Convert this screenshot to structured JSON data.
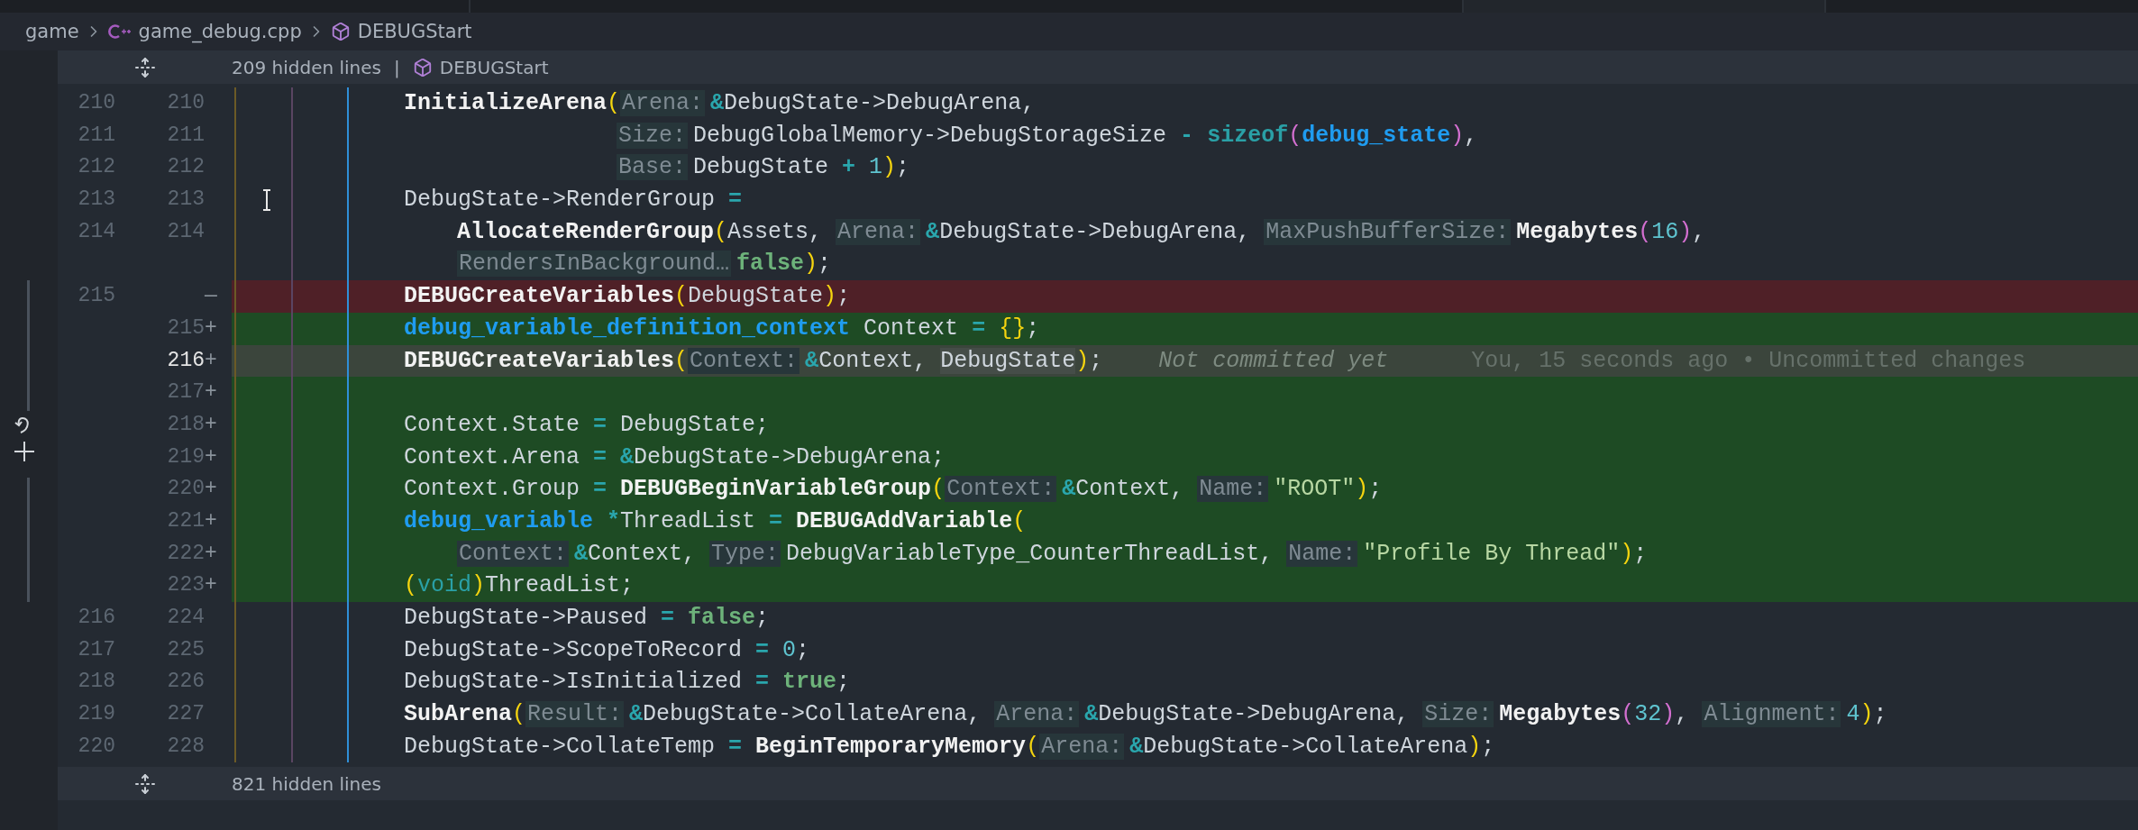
{
  "breadcrumb": {
    "items": [
      {
        "kind": "folder",
        "label": "game"
      },
      {
        "kind": "file",
        "label": "game_debug.cpp"
      },
      {
        "kind": "symbol",
        "label": "DEBUGStart"
      }
    ]
  },
  "top_fold": {
    "label": "209 hidden lines",
    "separator": "|",
    "symbol": "DEBUGStart"
  },
  "rows": [
    {
      "kind": "context",
      "old": "210",
      "new": "210",
      "current": false,
      "tokens": [
        {
          "kind": "fn",
          "text": "InitializeArena"
        },
        {
          "kind": "paren",
          "text": "("
        },
        {
          "kind": "hint",
          "text": "Arena:"
        },
        {
          "kind": "op",
          "text": "&"
        },
        {
          "kind": "plain",
          "text": "DebugState->DebugArena,"
        }
      ]
    },
    {
      "kind": "context",
      "old": "211",
      "new": "211",
      "current": false,
      "aligned": true,
      "tokens": [
        {
          "kind": "hint",
          "text": "Size:"
        },
        {
          "kind": "plain",
          "text": "DebugGlobalMemory->DebugStorageSize"
        },
        {
          "kind": "op",
          "text": " - "
        },
        {
          "kind": "builtin",
          "text": "sizeof"
        },
        {
          "kind": "paren2",
          "text": "("
        },
        {
          "kind": "kw",
          "text": "debug_state"
        },
        {
          "kind": "paren2",
          "text": ")"
        },
        {
          "kind": "plain",
          "text": ","
        }
      ]
    },
    {
      "kind": "context",
      "old": "212",
      "new": "212",
      "current": false,
      "aligned": true,
      "tokens": [
        {
          "kind": "hint",
          "text": "Base:"
        },
        {
          "kind": "plain",
          "text": "DebugState"
        },
        {
          "kind": "op",
          "text": " + "
        },
        {
          "kind": "num",
          "text": "1"
        },
        {
          "kind": "paren",
          "text": ")"
        },
        {
          "kind": "plain",
          "text": ";"
        }
      ]
    },
    {
      "kind": "context",
      "old": "213",
      "new": "213",
      "current": false,
      "tokens": [
        {
          "kind": "plain",
          "text": "DebugState->RenderGroup"
        },
        {
          "kind": "op",
          "text": " ="
        }
      ]
    },
    {
      "kind": "context",
      "old": "214",
      "new": "214",
      "current": false,
      "continued": true,
      "tokens": [
        {
          "kind": "fn",
          "text": "AllocateRenderGroup"
        },
        {
          "kind": "paren",
          "text": "("
        },
        {
          "kind": "plain",
          "text": "Assets, "
        },
        {
          "kind": "hint",
          "text": "Arena:"
        },
        {
          "kind": "op",
          "text": "&"
        },
        {
          "kind": "plain",
          "text": "DebugState->DebugArena, "
        },
        {
          "kind": "hint",
          "text": "MaxPushBufferSize:"
        },
        {
          "kind": "fn",
          "text": "Megabytes"
        },
        {
          "kind": "paren2",
          "text": "("
        },
        {
          "kind": "num",
          "text": "16"
        },
        {
          "kind": "paren2",
          "text": ")"
        },
        {
          "kind": "plain",
          "text": ","
        }
      ]
    },
    {
      "kind": "wrap",
      "current": false,
      "continued": true,
      "tokens": [
        {
          "kind": "hint",
          "text": "RendersInBackground…"
        },
        {
          "kind": "bool",
          "text": "false"
        },
        {
          "kind": "paren",
          "text": ")"
        },
        {
          "kind": "plain",
          "text": ";"
        }
      ]
    },
    {
      "kind": "removed",
      "old": "215",
      "sign": "—",
      "current": false,
      "tokens": [
        {
          "kind": "fn",
          "text": "DEBUGCreateVariables"
        },
        {
          "kind": "paren",
          "text": "("
        },
        {
          "kind": "plain",
          "text": "DebugState"
        },
        {
          "kind": "paren",
          "text": ")"
        },
        {
          "kind": "plain",
          "text": ";"
        }
      ]
    },
    {
      "kind": "added",
      "new": "215",
      "sign": "+",
      "current": false,
      "tokens": [
        {
          "kind": "kw",
          "text": "debug_variable_definition_context"
        },
        {
          "kind": "plain",
          "text": " Context"
        },
        {
          "kind": "op",
          "text": " = "
        },
        {
          "kind": "paren",
          "text": "{}"
        },
        {
          "kind": "plain",
          "text": ";"
        }
      ]
    },
    {
      "kind": "added",
      "new": "216",
      "sign": "+",
      "current": true,
      "tokens": [
        {
          "kind": "fn",
          "text": "DEBUGCreateVariables"
        },
        {
          "kind": "paren",
          "text": "("
        },
        {
          "kind": "hint",
          "text": "Context:"
        },
        {
          "kind": "op",
          "text": "&"
        },
        {
          "kind": "plain",
          "text": "Context, "
        },
        {
          "kind": "match",
          "text": "DebugState"
        },
        {
          "kind": "paren",
          "text": ")"
        },
        {
          "kind": "plain",
          "text": ";"
        }
      ],
      "blame": {
        "status": "Not committed yet",
        "detail": "You, 15 seconds ago • Uncommitted changes"
      }
    },
    {
      "kind": "added",
      "new": "217",
      "sign": "+",
      "current": false,
      "tokens": []
    },
    {
      "kind": "added",
      "new": "218",
      "sign": "+",
      "current": false,
      "tokens": [
        {
          "kind": "plain",
          "text": "Context.State"
        },
        {
          "kind": "op",
          "text": " = "
        },
        {
          "kind": "plain",
          "text": "DebugState;"
        }
      ]
    },
    {
      "kind": "added",
      "new": "219",
      "sign": "+",
      "current": false,
      "tokens": [
        {
          "kind": "plain",
          "text": "Context.Arena"
        },
        {
          "kind": "op",
          "text": " = &"
        },
        {
          "kind": "plain",
          "text": "DebugState->DebugArena;"
        }
      ]
    },
    {
      "kind": "added",
      "new": "220",
      "sign": "+",
      "current": false,
      "tokens": [
        {
          "kind": "plain",
          "text": "Context.Group"
        },
        {
          "kind": "op",
          "text": " = "
        },
        {
          "kind": "fn",
          "text": "DEBUGBeginVariableGroup"
        },
        {
          "kind": "paren",
          "text": "("
        },
        {
          "kind": "hint",
          "text": "Context:"
        },
        {
          "kind": "op",
          "text": "&"
        },
        {
          "kind": "plain",
          "text": "Context, "
        },
        {
          "kind": "hint",
          "text": "Name:"
        },
        {
          "kind": "str",
          "text": "\"ROOT\""
        },
        {
          "kind": "paren",
          "text": ")"
        },
        {
          "kind": "plain",
          "text": ";"
        }
      ]
    },
    {
      "kind": "added",
      "new": "221",
      "sign": "+",
      "current": false,
      "tokens": [
        {
          "kind": "kw",
          "text": "debug_variable"
        },
        {
          "kind": "op",
          "text": " *"
        },
        {
          "kind": "plain",
          "text": "ThreadList"
        },
        {
          "kind": "op",
          "text": " = "
        },
        {
          "kind": "fn",
          "text": "DEBUGAddVariable"
        },
        {
          "kind": "paren",
          "text": "("
        }
      ]
    },
    {
      "kind": "added",
      "new": "222",
      "sign": "+",
      "current": false,
      "continued": true,
      "tokens": [
        {
          "kind": "hint",
          "text": "Context:"
        },
        {
          "kind": "op",
          "text": "&"
        },
        {
          "kind": "plain",
          "text": "Context, "
        },
        {
          "kind": "hint",
          "text": "Type:"
        },
        {
          "kind": "plain",
          "text": "DebugVariableType_CounterThreadList, "
        },
        {
          "kind": "hint",
          "text": "Name:"
        },
        {
          "kind": "str",
          "text": "\"Profile By Thread\""
        },
        {
          "kind": "paren",
          "text": ")"
        },
        {
          "kind": "plain",
          "text": ";"
        }
      ]
    },
    {
      "kind": "added",
      "new": "223",
      "sign": "+",
      "current": false,
      "tokens": [
        {
          "kind": "paren",
          "text": "("
        },
        {
          "kind": "type",
          "text": "void"
        },
        {
          "kind": "paren",
          "text": ")"
        },
        {
          "kind": "plain",
          "text": "ThreadList;"
        }
      ]
    },
    {
      "kind": "context",
      "old": "216",
      "new": "224",
      "current": false,
      "tokens": [
        {
          "kind": "plain",
          "text": "DebugState->Paused"
        },
        {
          "kind": "op",
          "text": " = "
        },
        {
          "kind": "bool",
          "text": "false"
        },
        {
          "kind": "plain",
          "text": ";"
        }
      ]
    },
    {
      "kind": "context",
      "old": "217",
      "new": "225",
      "current": false,
      "tokens": [
        {
          "kind": "plain",
          "text": "DebugState->ScopeToRecord"
        },
        {
          "kind": "op",
          "text": " = "
        },
        {
          "kind": "num",
          "text": "0"
        },
        {
          "kind": "plain",
          "text": ";"
        }
      ]
    },
    {
      "kind": "context",
      "old": "218",
      "new": "226",
      "current": false,
      "tokens": [
        {
          "kind": "plain",
          "text": "DebugState->IsInitialized"
        },
        {
          "kind": "op",
          "text": " = "
        },
        {
          "kind": "bool",
          "text": "true"
        },
        {
          "kind": "plain",
          "text": ";"
        }
      ]
    },
    {
      "kind": "context",
      "old": "219",
      "new": "227",
      "current": false,
      "tokens": [
        {
          "kind": "fn",
          "text": "SubArena"
        },
        {
          "kind": "paren",
          "text": "("
        },
        {
          "kind": "hint",
          "text": "Result:"
        },
        {
          "kind": "op",
          "text": "&"
        },
        {
          "kind": "plain",
          "text": "DebugState->CollateArena, "
        },
        {
          "kind": "hint",
          "text": "Arena:"
        },
        {
          "kind": "op",
          "text": "&"
        },
        {
          "kind": "plain",
          "text": "DebugState->DebugArena, "
        },
        {
          "kind": "hint",
          "text": "Size:"
        },
        {
          "kind": "fn",
          "text": "Megabytes"
        },
        {
          "kind": "paren2",
          "text": "("
        },
        {
          "kind": "num",
          "text": "32"
        },
        {
          "kind": "paren2",
          "text": ")"
        },
        {
          "kind": "plain",
          "text": ", "
        },
        {
          "kind": "hint",
          "text": "Alignment:"
        },
        {
          "kind": "num",
          "text": "4"
        },
        {
          "kind": "paren",
          "text": ")"
        },
        {
          "kind": "plain",
          "text": ";"
        }
      ]
    },
    {
      "kind": "context",
      "old": "220",
      "new": "228",
      "current": false,
      "tokens": [
        {
          "kind": "plain",
          "text": "DebugState->CollateTemp"
        },
        {
          "kind": "op",
          "text": " = "
        },
        {
          "kind": "fn",
          "text": "BeginTemporaryMemory"
        },
        {
          "kind": "paren",
          "text": "("
        },
        {
          "kind": "hint",
          "text": "Arena:"
        },
        {
          "kind": "op",
          "text": "&"
        },
        {
          "kind": "plain",
          "text": "DebugState->CollateArena"
        },
        {
          "kind": "paren",
          "text": ")"
        },
        {
          "kind": "plain",
          "text": ";"
        }
      ]
    }
  ],
  "bottom_fold": {
    "label": "821 hidden lines"
  }
}
